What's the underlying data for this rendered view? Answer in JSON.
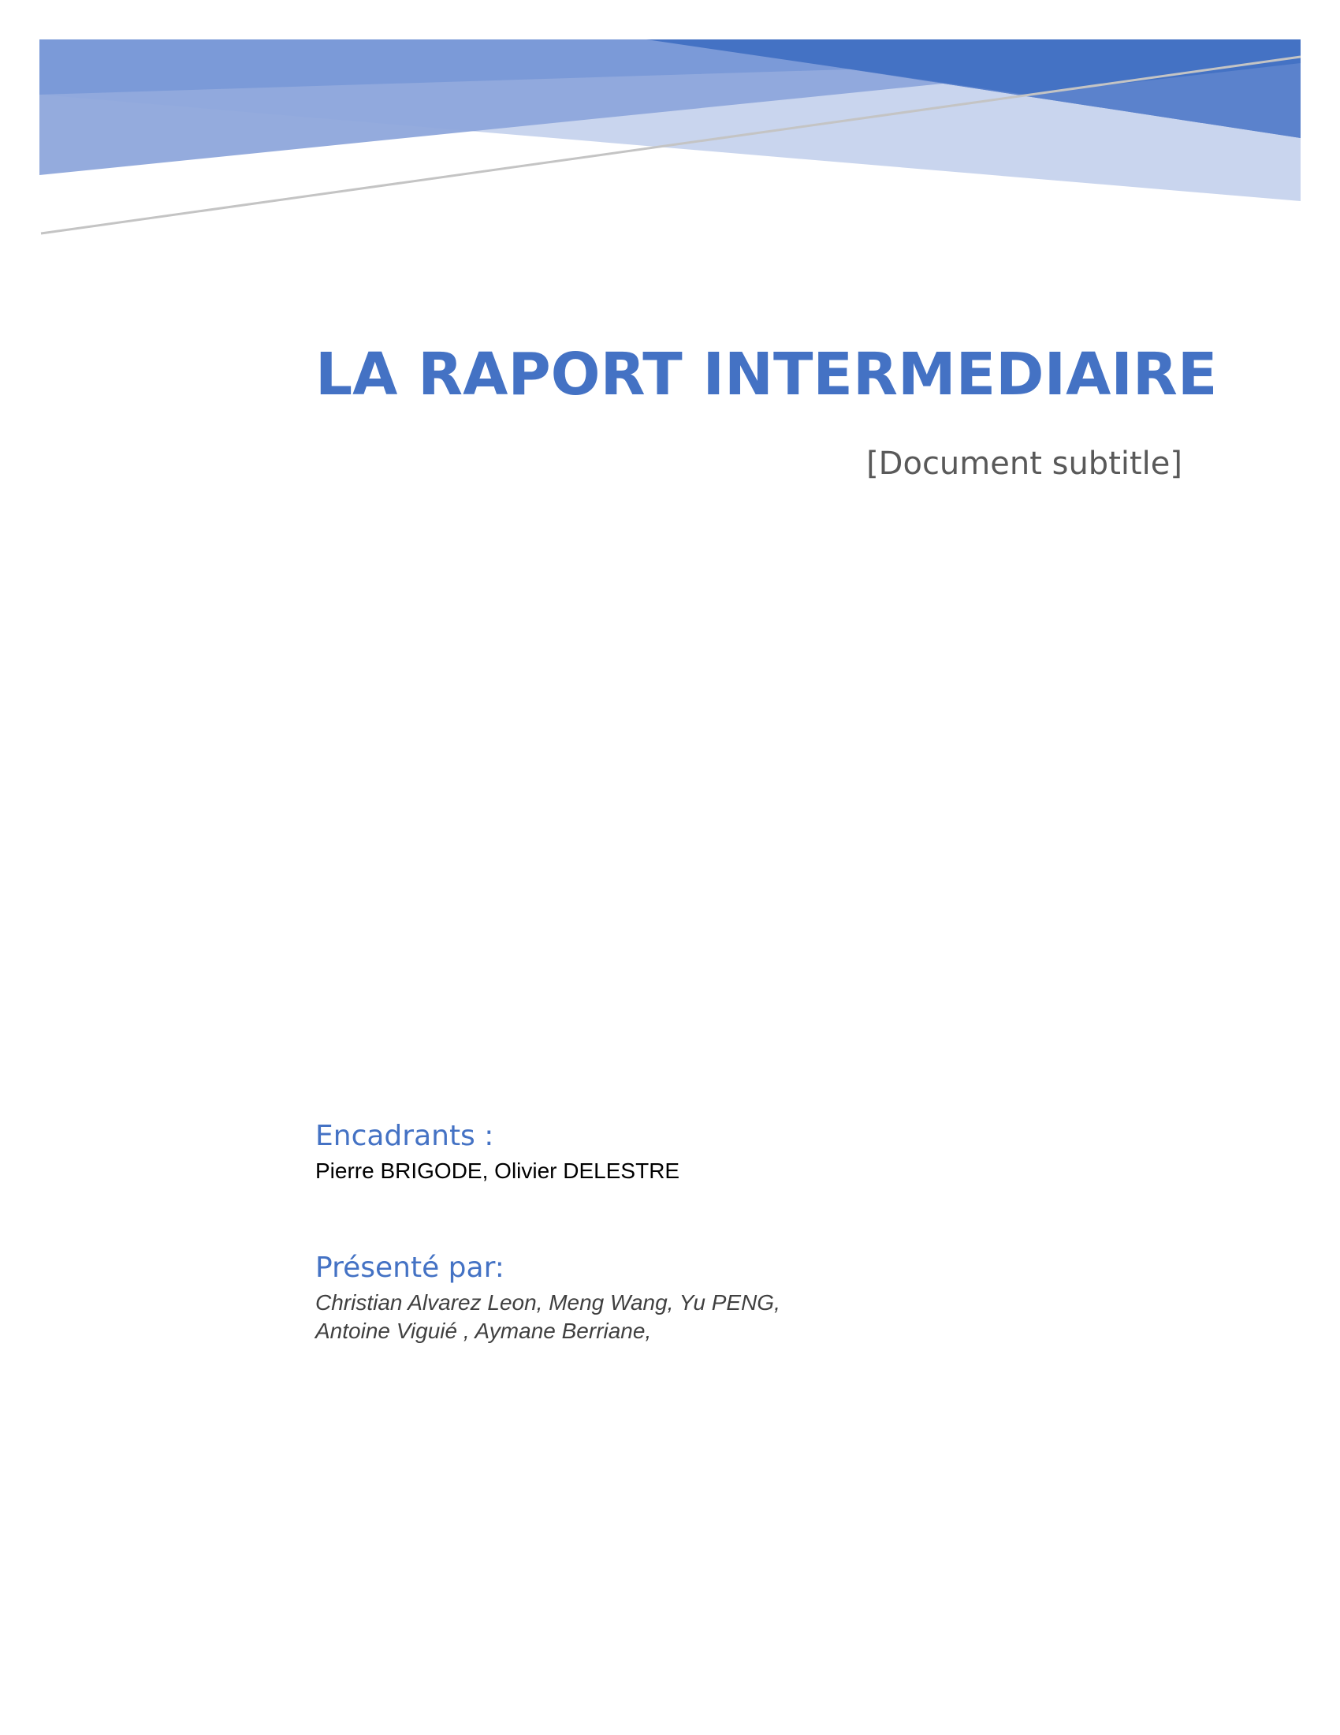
{
  "document": {
    "title": "LA RAPORT INTERMEDIAIRE",
    "subtitle": "[Document subtitle]",
    "supervisors": {
      "heading": "Encadrants :",
      "names": "Pierre BRIGODE, Olivier DELESTRE"
    },
    "presenters": {
      "heading": "Présenté par:",
      "lines": [
        "Christian Alvarez Leon, Meng Wang, Yu PENG,",
        "Antoine Viguié , Aymane Berriane,"
      ]
    }
  },
  "colors": {
    "accent": "#4472c4",
    "subtitle": "#595959",
    "body_text": "#000000",
    "italic_text": "#404040"
  }
}
